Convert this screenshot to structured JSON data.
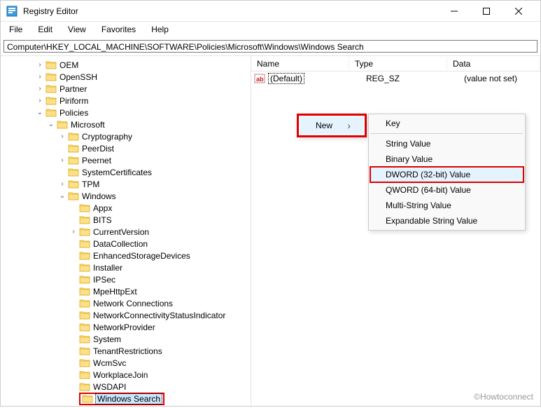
{
  "window": {
    "title": "Registry Editor"
  },
  "menu": {
    "file": "File",
    "edit": "Edit",
    "view": "View",
    "favorites": "Favorites",
    "help": "Help"
  },
  "address": {
    "value": "Computer\\HKEY_LOCAL_MACHINE\\SOFTWARE\\Policies\\Microsoft\\Windows\\Windows Search"
  },
  "tree": {
    "items": [
      {
        "indent": 4,
        "twisty": "›",
        "label": "OEM"
      },
      {
        "indent": 4,
        "twisty": "›",
        "label": "OpenSSH"
      },
      {
        "indent": 4,
        "twisty": "›",
        "label": "Partner"
      },
      {
        "indent": 4,
        "twisty": "›",
        "label": "Piriform"
      },
      {
        "indent": 4,
        "twisty": "⌄",
        "label": "Policies"
      },
      {
        "indent": 5,
        "twisty": "⌄",
        "label": "Microsoft"
      },
      {
        "indent": 6,
        "twisty": "›",
        "label": "Cryptography"
      },
      {
        "indent": 6,
        "twisty": "",
        "label": "PeerDist"
      },
      {
        "indent": 6,
        "twisty": "›",
        "label": "Peernet"
      },
      {
        "indent": 6,
        "twisty": "",
        "label": "SystemCertificates"
      },
      {
        "indent": 6,
        "twisty": "›",
        "label": "TPM"
      },
      {
        "indent": 6,
        "twisty": "⌄",
        "label": "Windows"
      },
      {
        "indent": 7,
        "twisty": "",
        "label": "Appx"
      },
      {
        "indent": 7,
        "twisty": "",
        "label": "BITS"
      },
      {
        "indent": 7,
        "twisty": "›",
        "label": "CurrentVersion"
      },
      {
        "indent": 7,
        "twisty": "",
        "label": "DataCollection"
      },
      {
        "indent": 7,
        "twisty": "",
        "label": "EnhancedStorageDevices"
      },
      {
        "indent": 7,
        "twisty": "",
        "label": "Installer"
      },
      {
        "indent": 7,
        "twisty": "",
        "label": "IPSec"
      },
      {
        "indent": 7,
        "twisty": "",
        "label": "MpeHttpExt"
      },
      {
        "indent": 7,
        "twisty": "",
        "label": "Network Connections"
      },
      {
        "indent": 7,
        "twisty": "",
        "label": "NetworkConnectivityStatusIndicator"
      },
      {
        "indent": 7,
        "twisty": "",
        "label": "NetworkProvider"
      },
      {
        "indent": 7,
        "twisty": "",
        "label": "System"
      },
      {
        "indent": 7,
        "twisty": "",
        "label": "TenantRestrictions"
      },
      {
        "indent": 7,
        "twisty": "",
        "label": "WcmSvc"
      },
      {
        "indent": 7,
        "twisty": "",
        "label": "WorkplaceJoin"
      },
      {
        "indent": 7,
        "twisty": "",
        "label": "WSDAPI"
      },
      {
        "indent": 7,
        "twisty": "",
        "label": "Windows Search",
        "highlight": true,
        "selected": true
      }
    ]
  },
  "list": {
    "headers": {
      "name": "Name",
      "type": "Type",
      "data": "Data"
    },
    "rows": [
      {
        "name": "(Default)",
        "type": "REG_SZ",
        "data": "(value not set)"
      }
    ]
  },
  "context1": {
    "new": "New"
  },
  "context2": {
    "key": "Key",
    "string": "String Value",
    "binary": "Binary Value",
    "dword": "DWORD (32-bit) Value",
    "qword": "QWORD (64-bit) Value",
    "multi": "Multi-String Value",
    "expand": "Expandable String Value"
  },
  "watermark": "©Howtoconnect"
}
